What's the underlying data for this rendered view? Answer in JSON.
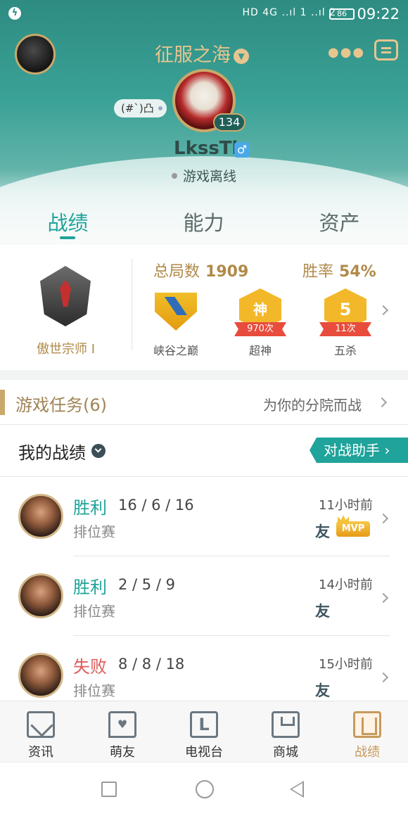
{
  "status_bar": {
    "time": "09:22",
    "battery": "86",
    "indicators": "HD 4G ..ıl 1 ..ıl 2"
  },
  "header": {
    "title": "征服之海",
    "player_tag": "(#`)凸",
    "level": "134",
    "username": "LkssTl",
    "gender": "♂",
    "status": "游戏离线",
    "accent_color": "#e6c58f"
  },
  "tabs": [
    {
      "label": "战绩",
      "active": true
    },
    {
      "label": "能力",
      "active": false
    },
    {
      "label": "资产",
      "active": false
    }
  ],
  "stats": {
    "rank_name": "傲世宗师 I",
    "total_games_label": "总局数",
    "total_games": "1909",
    "win_rate_label": "胜率",
    "win_rate": "54%",
    "badges": [
      {
        "label": "峡谷之巅",
        "count": "",
        "icon": "summoners-rift-crest-icon"
      },
      {
        "label": "超神",
        "count": "970次",
        "icon": "legendary-badge-icon",
        "glyph": "神"
      },
      {
        "label": "五杀",
        "count": "11次",
        "icon": "pentakill-badge-icon",
        "glyph": "5"
      }
    ]
  },
  "tasks": {
    "title": "游戏任务(6)",
    "right_text": "为你的分院而战"
  },
  "records": {
    "title": "我的战绩",
    "assistant_button": "对战助手 ›",
    "matches": [
      {
        "result": "胜利",
        "kda": "16 / 6 / 16",
        "mode": "排位赛",
        "time": "11小时前",
        "friend": "友",
        "mvp": "MVP",
        "win": true
      },
      {
        "result": "胜利",
        "kda": "2 / 5 / 9",
        "mode": "排位赛",
        "time": "14小时前",
        "friend": "友",
        "mvp": "",
        "win": true
      },
      {
        "result": "失败",
        "kda": "8 / 8 / 18",
        "mode": "排位赛",
        "time": "15小时前",
        "friend": "友",
        "mvp": "",
        "win": false
      }
    ]
  },
  "bottom_nav": [
    {
      "label": "资讯",
      "icon": "news-icon",
      "active": false
    },
    {
      "label": "萌友",
      "icon": "friends-icon",
      "active": false
    },
    {
      "label": "电视台",
      "icon": "tv-icon",
      "active": false
    },
    {
      "label": "商城",
      "icon": "shop-icon",
      "active": false
    },
    {
      "label": "战绩",
      "icon": "records-icon",
      "active": true
    }
  ],
  "colors": {
    "teal": "#1fa39a",
    "gold": "#c9a86a",
    "lose_red": "#e05a5a"
  }
}
